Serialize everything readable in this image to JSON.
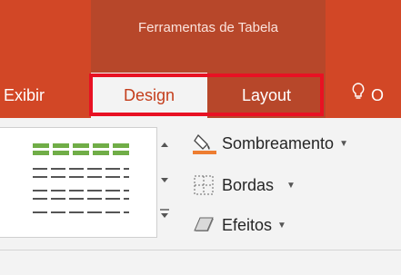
{
  "contextual_group": "Ferramentas de Tabela",
  "tabs": {
    "exibir": "Exibir",
    "design": "Design",
    "layout": "Layout",
    "tell_me": "O"
  },
  "commands": {
    "shading": "Sombreamento",
    "borders": "Bordas",
    "effects": "Efeitos"
  },
  "colors": {
    "accent": "#d24726",
    "contextual": "#b7472a",
    "highlight": "#e81123",
    "table_green": "#70ad47"
  },
  "icons": {
    "tell_me": "lightbulb-icon",
    "shading": "paint-bucket-icon",
    "borders": "borders-icon",
    "effects": "effects-icon"
  }
}
